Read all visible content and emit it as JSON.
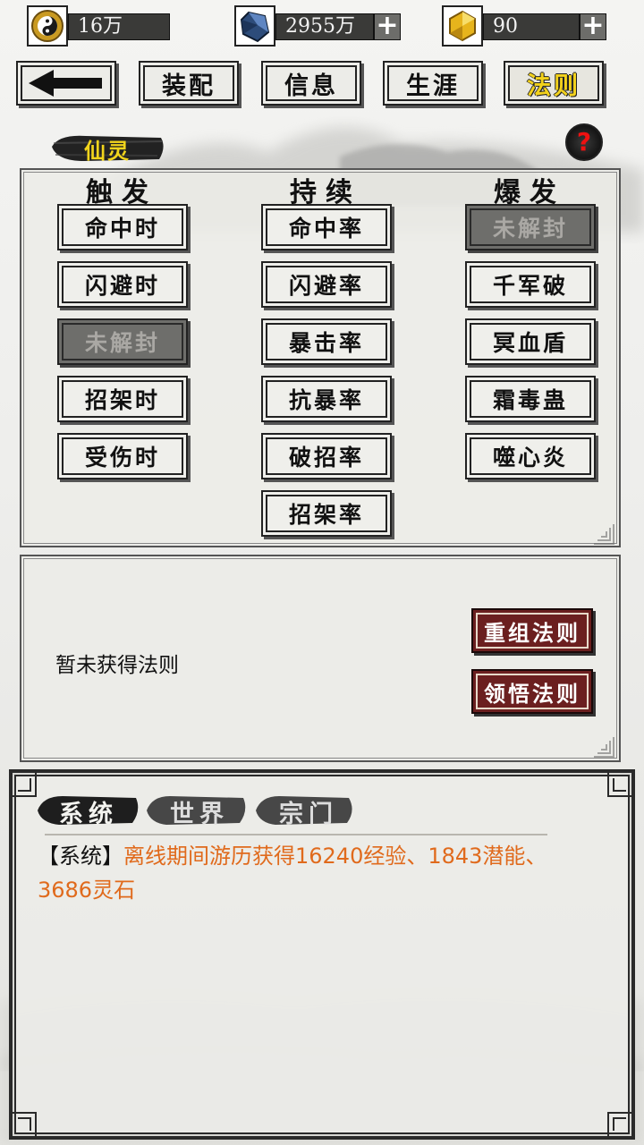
{
  "currencies": [
    {
      "id": "coin",
      "icon": "yin-yang-coin-icon",
      "value": "16万",
      "has_plus": false
    },
    {
      "id": "crystal",
      "icon": "blue-crystal-icon",
      "value": "2955万",
      "has_plus": true
    },
    {
      "id": "gem",
      "icon": "gold-gem-icon",
      "value": "90",
      "has_plus": true
    }
  ],
  "nav": {
    "back_icon": "arrow-left-icon",
    "tabs": [
      {
        "label": "装配",
        "active": false
      },
      {
        "label": "信息",
        "active": false
      },
      {
        "label": "生涯",
        "active": false
      },
      {
        "label": "法则",
        "active": true
      }
    ]
  },
  "section_title": "仙灵",
  "help_label": "?",
  "columns": [
    {
      "title": "触发",
      "items": [
        {
          "label": "命中时",
          "locked": false
        },
        {
          "label": "闪避时",
          "locked": false
        },
        {
          "label": "未解封",
          "locked": true
        },
        {
          "label": "招架时",
          "locked": false
        },
        {
          "label": "受伤时",
          "locked": false
        }
      ]
    },
    {
      "title": "持续",
      "items": [
        {
          "label": "命中率",
          "locked": false
        },
        {
          "label": "闪避率",
          "locked": false
        },
        {
          "label": "暴击率",
          "locked": false
        },
        {
          "label": "抗暴率",
          "locked": false
        },
        {
          "label": "破招率",
          "locked": false
        },
        {
          "label": "招架率",
          "locked": false
        }
      ]
    },
    {
      "title": "爆发",
      "items": [
        {
          "label": "未解封",
          "locked": true
        },
        {
          "label": "千军破",
          "locked": false
        },
        {
          "label": "冥血盾",
          "locked": false
        },
        {
          "label": "霜毒蛊",
          "locked": false
        },
        {
          "label": "噬心炎",
          "locked": false
        }
      ]
    }
  ],
  "rule_panel": {
    "status": "暂未获得法则",
    "reset_button": "重组法则",
    "comprehend_button": "领悟法则"
  },
  "chat": {
    "tabs": [
      {
        "label": "系统",
        "active": true
      },
      {
        "label": "世界",
        "active": false
      },
      {
        "label": "宗门",
        "active": false
      }
    ],
    "messages": [
      {
        "prefix": "【系统】",
        "text": "离线期间游历获得16240经验、1843潜能、3686灵石"
      }
    ]
  },
  "colors": {
    "accent_yellow": "#f3d21c",
    "button_red": "#6b1f1f",
    "message_orange": "#e06a1c",
    "help_red": "#e11111"
  }
}
